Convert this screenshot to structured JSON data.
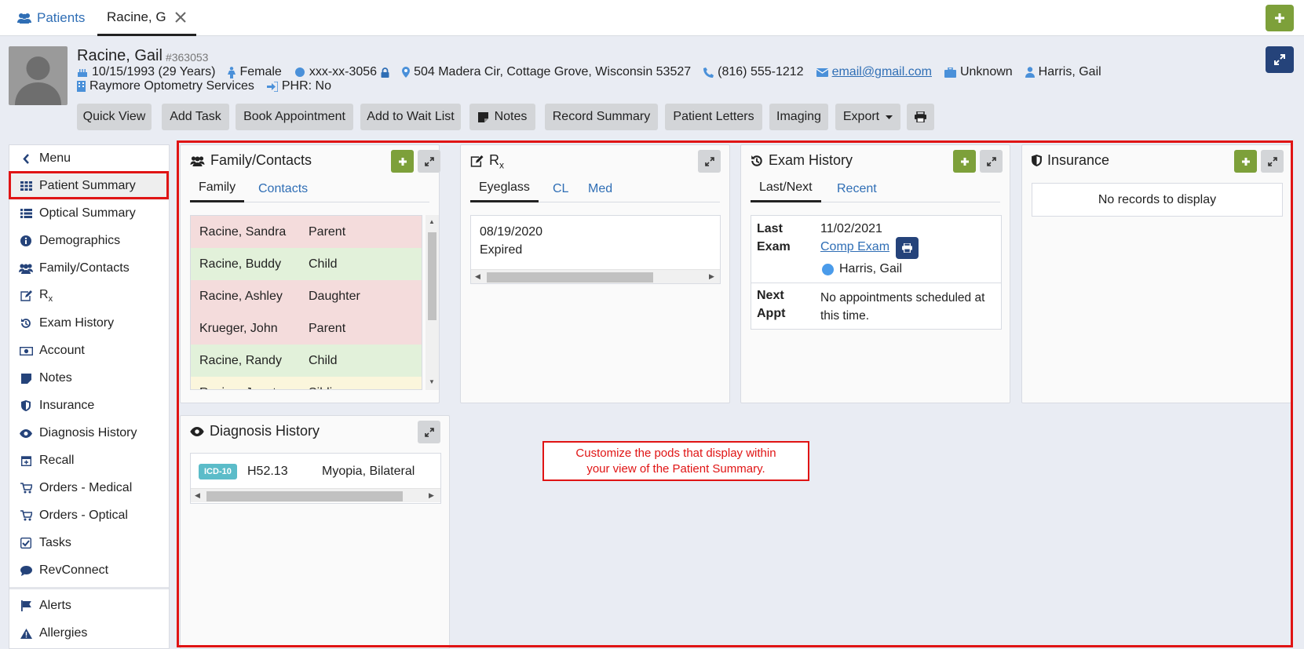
{
  "tabs": {
    "patients_label": "Patients",
    "active_label": "Racine, G"
  },
  "patient": {
    "name": "Racine, Gail",
    "id": "#363053",
    "dob": "10/15/1993 (29 Years)",
    "gender": "Female",
    "ssn": "xxx-xx-3056",
    "address": "504 Madera Cir, Cottage Grove, Wisconsin 53527",
    "phone": "(816) 555-1212",
    "email": "email@gmail.com",
    "employment": "Unknown",
    "provider": "Harris, Gail",
    "location": "Raymore Optometry Services",
    "phr": "PHR: No"
  },
  "actions": [
    "Quick View",
    "Add Task",
    "Book Appointment",
    "Add to Wait List",
    "Notes",
    "Record Summary",
    "Patient Letters",
    "Imaging",
    "Export"
  ],
  "sidebar": {
    "menu_label": "Menu",
    "items": [
      "Patient Summary",
      "Optical Summary",
      "Demographics",
      "Family/Contacts",
      "R",
      "Exam History",
      "Account",
      "Notes",
      "Insurance",
      "Diagnosis History",
      "Recall",
      "Orders - Medical",
      "Orders - Optical",
      "Tasks",
      "RevConnect"
    ],
    "rx_sub": "x",
    "bottom_items": [
      "Alerts",
      "Allergies"
    ]
  },
  "family_pod": {
    "title": "Family/Contacts",
    "tabs": [
      "Family",
      "Contacts"
    ],
    "rows": [
      {
        "name": "Racine, Sandra",
        "rel": "Parent"
      },
      {
        "name": "Racine, Buddy",
        "rel": "Child"
      },
      {
        "name": "Racine, Ashley",
        "rel": "Daughter"
      },
      {
        "name": "Krueger, John",
        "rel": "Parent"
      },
      {
        "name": "Racine, Randy",
        "rel": "Child"
      },
      {
        "name": "Racine, Janet",
        "rel": "Sibling"
      }
    ],
    "row_colors": [
      "#f4dcdc",
      "#e2f1da",
      "#f4dcdc",
      "#f4dcdc",
      "#e2f1da",
      "#fbf6dc"
    ]
  },
  "rx_pod": {
    "title": "R",
    "title_sub": "x",
    "tabs": [
      "Eyeglass",
      "CL",
      "Med"
    ],
    "date": "08/19/2020",
    "status": "Expired"
  },
  "exam_pod": {
    "title": "Exam History",
    "tabs": [
      "Last/Next",
      "Recent"
    ],
    "last_label": "Last",
    "exam_label": "Exam",
    "last_date": "11/02/2021",
    "exam_link": "Comp Exam",
    "provider": "Harris, Gail",
    "next_label": "Next",
    "appt_label": "Appt",
    "next_text": "No appointments scheduled at this time."
  },
  "insurance_pod": {
    "title": "Insurance",
    "empty": "No records to display"
  },
  "diagnosis_pod": {
    "title": "Diagnosis History",
    "badge": "ICD-10",
    "code": "H52.13",
    "desc": "Myopia, Bilateral"
  },
  "annotation": {
    "line1": "Customize the pods that display within",
    "line2": "your view of the Patient Summary."
  },
  "colors": {
    "accent_green": "#7da03a",
    "navy": "#25437a",
    "link": "#2f6eb5",
    "highlight_red": "#e01414"
  }
}
